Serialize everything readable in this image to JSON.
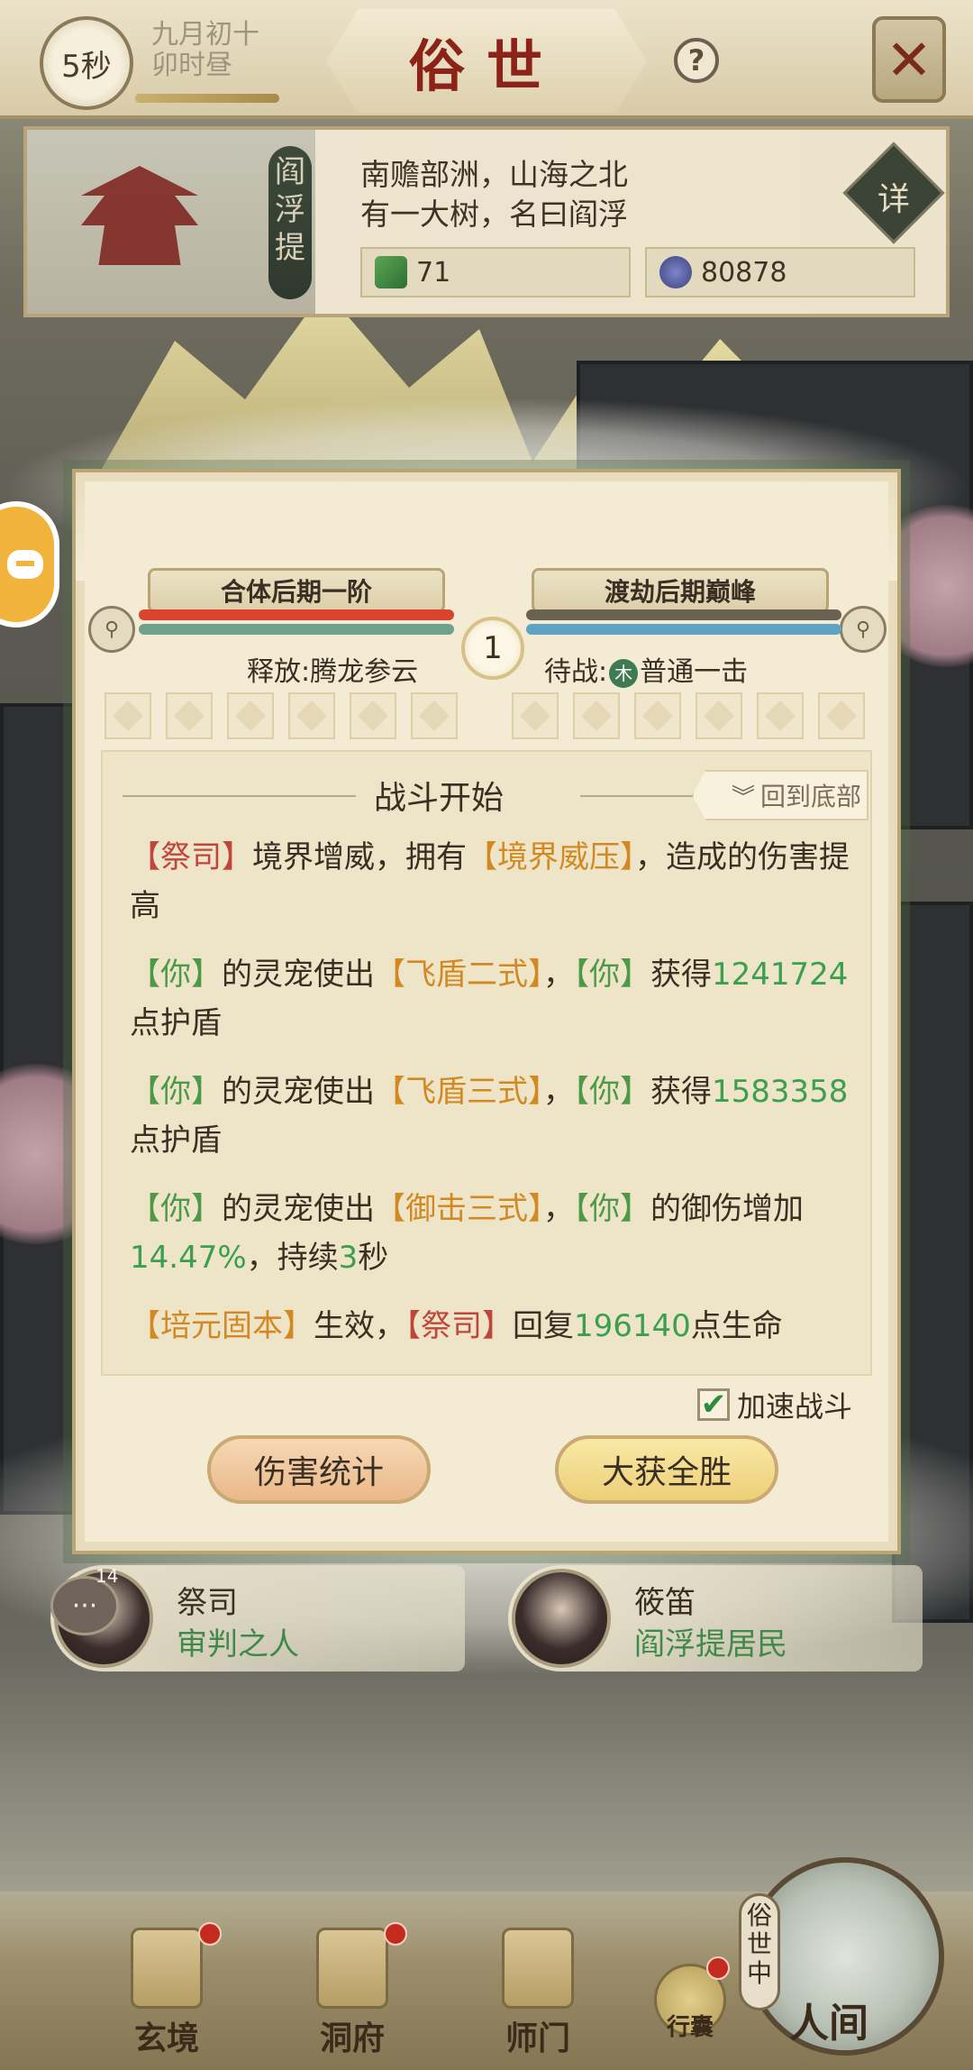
{
  "header": {
    "timer": "5秒",
    "date_line1": "九月初十",
    "date_line2": "卯时昼",
    "title": "俗世",
    "help_label": "?",
    "close_label": "✕"
  },
  "location": {
    "tag": "阎浮提",
    "desc_line1": "南赡部洲，山海之北",
    "desc_line2": "有一大树，名曰阎浮",
    "resource_1": "71",
    "resource_2": "80878",
    "detail_label": "详"
  },
  "battle": {
    "left_fighter": {
      "rank": "合体后期一阶",
      "hp_fraction": 1.0
    },
    "right_fighter": {
      "rank": "渡劫后期巅峰",
      "hp_fraction": 1.0
    },
    "round": "1",
    "left_skill": "释放:腾龙参云",
    "right_skill_prefix": "待战:",
    "right_skill_element": "木",
    "right_skill": "普通一击",
    "log_title": "战斗开始",
    "back_to_bottom": "回到底部",
    "log": [
      [
        {
          "t": "【祭司】",
          "c": "c-red"
        },
        {
          "t": "境界增威，拥有"
        },
        {
          "t": "【境界威压】",
          "c": "c-orange"
        },
        {
          "t": "，造成的伤害提高"
        }
      ],
      [
        {
          "t": "【你】",
          "c": "c-green"
        },
        {
          "t": "的灵宠使出"
        },
        {
          "t": "【飞盾二式】",
          "c": "c-orange"
        },
        {
          "t": "，"
        },
        {
          "t": "【你】",
          "c": "c-green"
        },
        {
          "t": "获得"
        },
        {
          "t": "1241724",
          "c": "c-num"
        },
        {
          "t": "点护盾"
        }
      ],
      [
        {
          "t": "【你】",
          "c": "c-green"
        },
        {
          "t": "的灵宠使出"
        },
        {
          "t": "【飞盾三式】",
          "c": "c-orange"
        },
        {
          "t": "，"
        },
        {
          "t": "【你】",
          "c": "c-green"
        },
        {
          "t": "获得"
        },
        {
          "t": "1583358",
          "c": "c-num"
        },
        {
          "t": "点护盾"
        }
      ],
      [
        {
          "t": "【你】",
          "c": "c-green"
        },
        {
          "t": "的灵宠使出"
        },
        {
          "t": "【御击三式】",
          "c": "c-orange"
        },
        {
          "t": "，"
        },
        {
          "t": "【你】",
          "c": "c-green"
        },
        {
          "t": "的御伤增加"
        },
        {
          "t": "14.47%",
          "c": "c-num"
        },
        {
          "t": "，持续"
        },
        {
          "t": "3",
          "c": "c-num"
        },
        {
          "t": "秒"
        }
      ],
      [
        {
          "t": "【培元固本】",
          "c": "c-orange"
        },
        {
          "t": "生效，"
        },
        {
          "t": "【祭司】",
          "c": "c-red"
        },
        {
          "t": "回复"
        },
        {
          "t": "196140",
          "c": "c-num"
        },
        {
          "t": "点生命"
        }
      ]
    ],
    "speed_label": "加速战斗",
    "speed_checked": true,
    "stats_button": "伤害统计",
    "win_button": "大获全胜"
  },
  "npcs": [
    {
      "name": "祭司",
      "title": "审判之人"
    },
    {
      "name": "筱笛",
      "title": "阎浮提居民"
    }
  ],
  "chat": {
    "icon": "chat-icon",
    "count": "14"
  },
  "nav": {
    "xuanjing": "玄境",
    "dongfu": "洞府",
    "shimen": "师门",
    "bag": "行囊",
    "renjian": "人间",
    "world_tag": "俗世中"
  },
  "colors": {
    "hp_left_top": "#d9452c",
    "hp_left_bottom": "#6fa28c",
    "hp_right_top": "#6a6250",
    "hp_right_bottom": "#5ea3c4",
    "title_red": "#8b2318"
  }
}
